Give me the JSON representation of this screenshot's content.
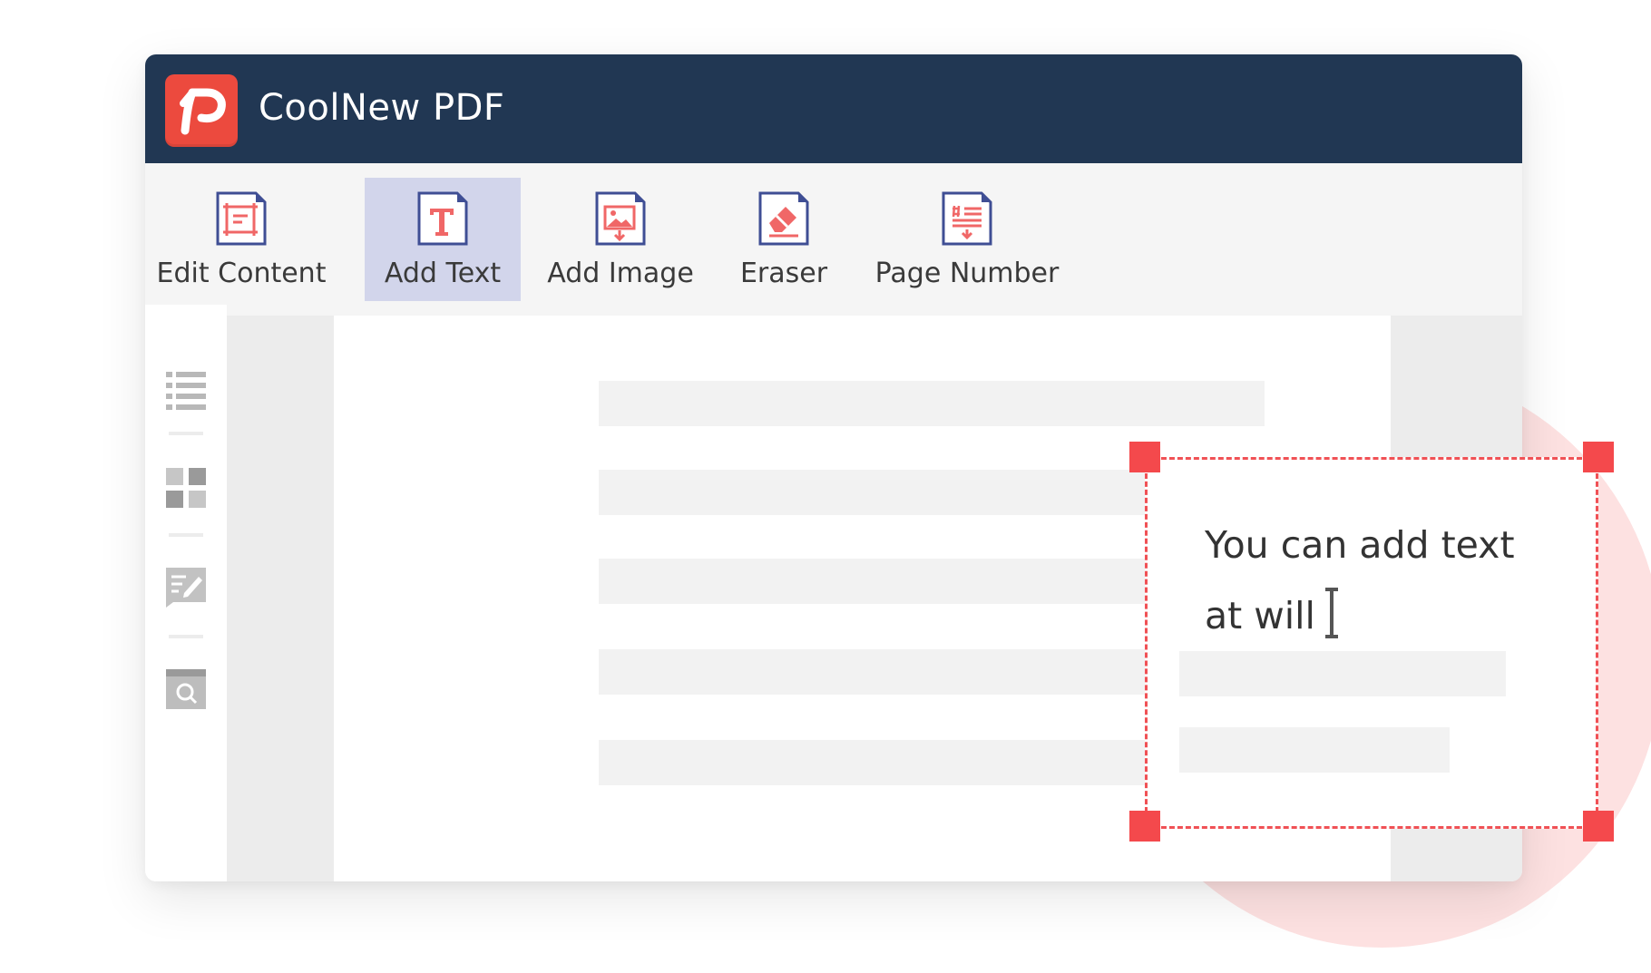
{
  "app": {
    "title": "CoolNew PDF",
    "logo_icon": "coolnew-pdf-logo-icon",
    "brand_color": "#ec4a3e",
    "titlebar_color": "#213753"
  },
  "toolbar": {
    "tools": [
      {
        "label": "Edit Content",
        "icon": "edit-content-icon",
        "active": false
      },
      {
        "label": "Add Text",
        "icon": "add-text-icon",
        "active": true
      },
      {
        "label": "Add Image",
        "icon": "add-image-icon",
        "active": false
      },
      {
        "label": "Eraser",
        "icon": "eraser-icon",
        "active": false
      },
      {
        "label": "Page Number",
        "icon": "page-number-icon",
        "active": false
      }
    ]
  },
  "sidebar": {
    "items": [
      {
        "icon": "outline-list-icon"
      },
      {
        "icon": "thumbnails-grid-icon"
      },
      {
        "icon": "annotation-icon"
      },
      {
        "icon": "search-icon"
      }
    ]
  },
  "textbox": {
    "line1": "You can add text",
    "line2": "at will",
    "accent_color": "#f4494c"
  }
}
